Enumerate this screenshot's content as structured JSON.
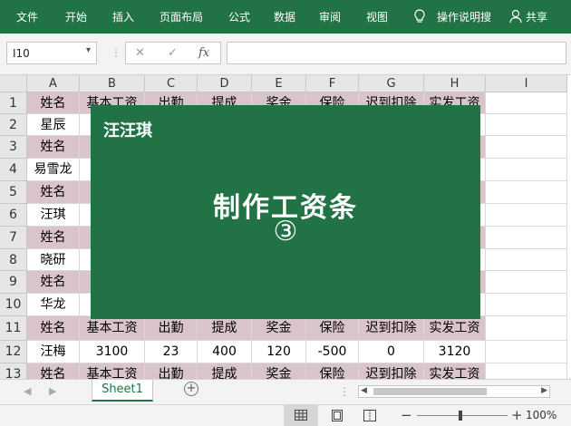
{
  "ribbon": {
    "tabs": [
      "文件",
      "开始",
      "插入",
      "页面布局",
      "公式",
      "数据",
      "审阅",
      "视图"
    ],
    "tellme": "操作说明搜",
    "share": "共享"
  },
  "formula_bar": {
    "name_box": "I10",
    "fx": "fx",
    "value": ""
  },
  "columns": [
    "A",
    "B",
    "C",
    "D",
    "E",
    "F",
    "G",
    "H",
    "I"
  ],
  "rows": [
    {
      "n": "1",
      "cells": [
        "姓名",
        "基本工资",
        "出勤",
        "提成",
        "奖金",
        "保险",
        "迟到扣除",
        "实发工资",
        ""
      ]
    },
    {
      "n": "2",
      "cells": [
        "星辰",
        "",
        "",
        "",
        "",
        "",
        "",
        "",
        ""
      ]
    },
    {
      "n": "3",
      "cells": [
        "姓名",
        "基",
        "",
        "",
        "",
        "",
        "",
        "资",
        ""
      ]
    },
    {
      "n": "4",
      "cells": [
        "易雪龙",
        "",
        "",
        "",
        "",
        "",
        "",
        "",
        ""
      ]
    },
    {
      "n": "5",
      "cells": [
        "姓名",
        "基",
        "",
        "",
        "",
        "",
        "",
        "资",
        ""
      ]
    },
    {
      "n": "6",
      "cells": [
        "汪琪",
        "",
        "",
        "",
        "",
        "",
        "",
        "",
        ""
      ]
    },
    {
      "n": "7",
      "cells": [
        "姓名",
        "基",
        "",
        "",
        "",
        "",
        "",
        "资",
        ""
      ]
    },
    {
      "n": "8",
      "cells": [
        "晓研",
        "",
        "",
        "",
        "",
        "",
        "",
        "",
        ""
      ]
    },
    {
      "n": "9",
      "cells": [
        "姓名",
        "基",
        "",
        "",
        "",
        "",
        "",
        "资",
        ""
      ]
    },
    {
      "n": "10",
      "cells": [
        "华龙",
        "",
        "",
        "",
        "",
        "",
        "",
        "",
        ""
      ]
    },
    {
      "n": "11",
      "cells": [
        "姓名",
        "基本工资",
        "出勤",
        "提成",
        "奖金",
        "保险",
        "迟到扣除",
        "实发工资",
        ""
      ]
    },
    {
      "n": "12",
      "cells": [
        "汪梅",
        "3100",
        "23",
        "400",
        "120",
        "-500",
        "0",
        "3120",
        ""
      ]
    },
    {
      "n": "13",
      "cells": [
        "姓名",
        "基本工资",
        "出勤",
        "提成",
        "奖金",
        "保险",
        "迟到扣除",
        "实发工资",
        ""
      ]
    }
  ],
  "overlay": {
    "brand": "汪汪琪",
    "title": "制作工资条",
    "number": "③"
  },
  "sheet_tabs": {
    "active": "Sheet1"
  },
  "status": {
    "zoom": "100%"
  },
  "colors": {
    "accent": "#217346",
    "header_fill": "#d9c4cc"
  }
}
